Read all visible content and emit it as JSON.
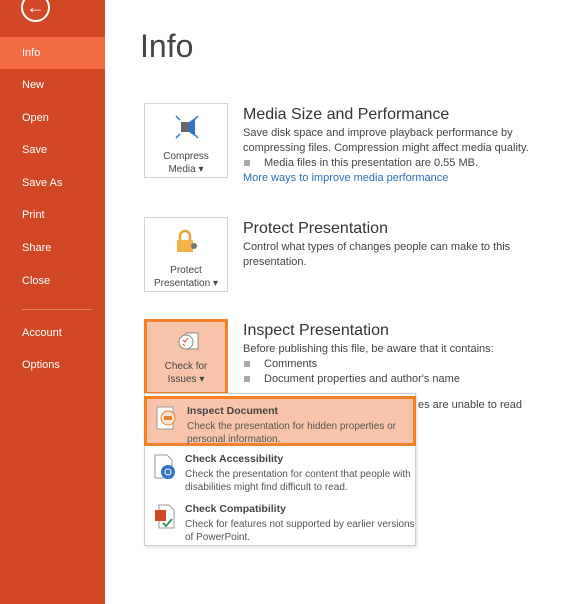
{
  "sidebar": {
    "back_icon": "back-arrow-icon",
    "items": [
      {
        "label": "Info",
        "active": true
      },
      {
        "label": "New"
      },
      {
        "label": "Open"
      },
      {
        "label": "Save"
      },
      {
        "label": "Save As"
      },
      {
        "label": "Print"
      },
      {
        "label": "Share"
      },
      {
        "label": "Close"
      },
      {
        "label": "Account"
      },
      {
        "label": "Options"
      }
    ]
  },
  "page": {
    "title": "Info"
  },
  "media": {
    "button_line1": "Compress",
    "button_line2": "Media ▾",
    "heading": "Media Size and Performance",
    "desc": "Save disk space and improve playback performance by compressing files. Compression might affect media quality.",
    "bullet": "Media files in this presentation are 0.55 MB.",
    "link": "More ways to improve media performance"
  },
  "protect": {
    "button_line1": "Protect",
    "button_line2": "Presentation ▾",
    "heading": "Protect Presentation",
    "desc": "Control what types of changes people can make to this presentation."
  },
  "inspect": {
    "button_line1": "Check for",
    "button_line2": "Issues ▾",
    "heading": "Inspect Presentation",
    "desc": "Before publishing this file, be aware that it contains:",
    "bullets": [
      "Comments",
      "Document properties and author's name"
    ],
    "partial": "es are unable to read"
  },
  "menu": [
    {
      "title": "Inspect Document",
      "desc": "Check the presentation for hidden properties or personal information.",
      "highlighted": true
    },
    {
      "title": "Check Accessibility",
      "desc": "Check the presentation for content that people with disabilities might find difficult to read."
    },
    {
      "title": "Check Compatibility",
      "desc": "Check for features not supported by earlier versions of PowerPoint."
    }
  ],
  "colors": {
    "sidebar": "#d24726",
    "active": "#f26b43",
    "highlight": "#f58025",
    "link": "#2b70b8"
  }
}
